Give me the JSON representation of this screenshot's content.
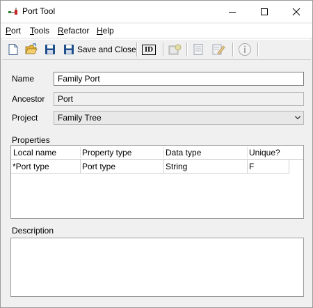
{
  "window": {
    "title": "Port Tool"
  },
  "menu": {
    "items": [
      {
        "key": "P",
        "rest": "ort"
      },
      {
        "key": "T",
        "rest": "ools"
      },
      {
        "key": "R",
        "rest": "efactor"
      },
      {
        "key": "H",
        "rest": "elp"
      }
    ]
  },
  "toolbar": {
    "save_and_close_label": "Save and Close",
    "id_label": "ID"
  },
  "form": {
    "name_label": "Name",
    "name_value": "Family Port",
    "ancestor_label": "Ancestor",
    "ancestor_value": "Port",
    "project_label": "Project",
    "project_value": "Family Tree"
  },
  "properties": {
    "label": "Properties",
    "columns": [
      "Local name",
      "Property type",
      "Data type",
      "Unique?"
    ],
    "rows": [
      [
        "*Port type",
        "Port type",
        "String",
        "F"
      ]
    ]
  },
  "description": {
    "label": "Description",
    "value": ""
  },
  "colors": {
    "window_bg": "#f0f0f0",
    "titlebar_bg": "#ffffff",
    "save_icon_blue": "#1f4e8c",
    "folder_yellow": "#e8b53a"
  }
}
